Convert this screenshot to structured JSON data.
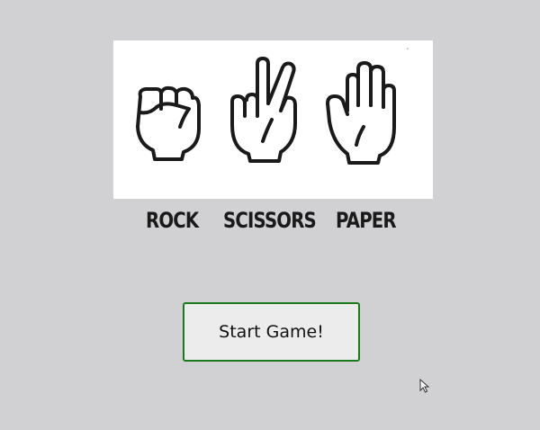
{
  "banner": {
    "hands": [
      {
        "label": "ROCK",
        "icon": "rock-fist-icon"
      },
      {
        "label": "SCISSORS",
        "icon": "scissors-hand-icon"
      },
      {
        "label": "PAPER",
        "icon": "paper-hand-icon"
      }
    ]
  },
  "start_button": {
    "label": "Start Game!"
  },
  "colors": {
    "background": "#d1d0d2",
    "button_border": "#1b7a1b",
    "button_fill": "#ececec"
  }
}
